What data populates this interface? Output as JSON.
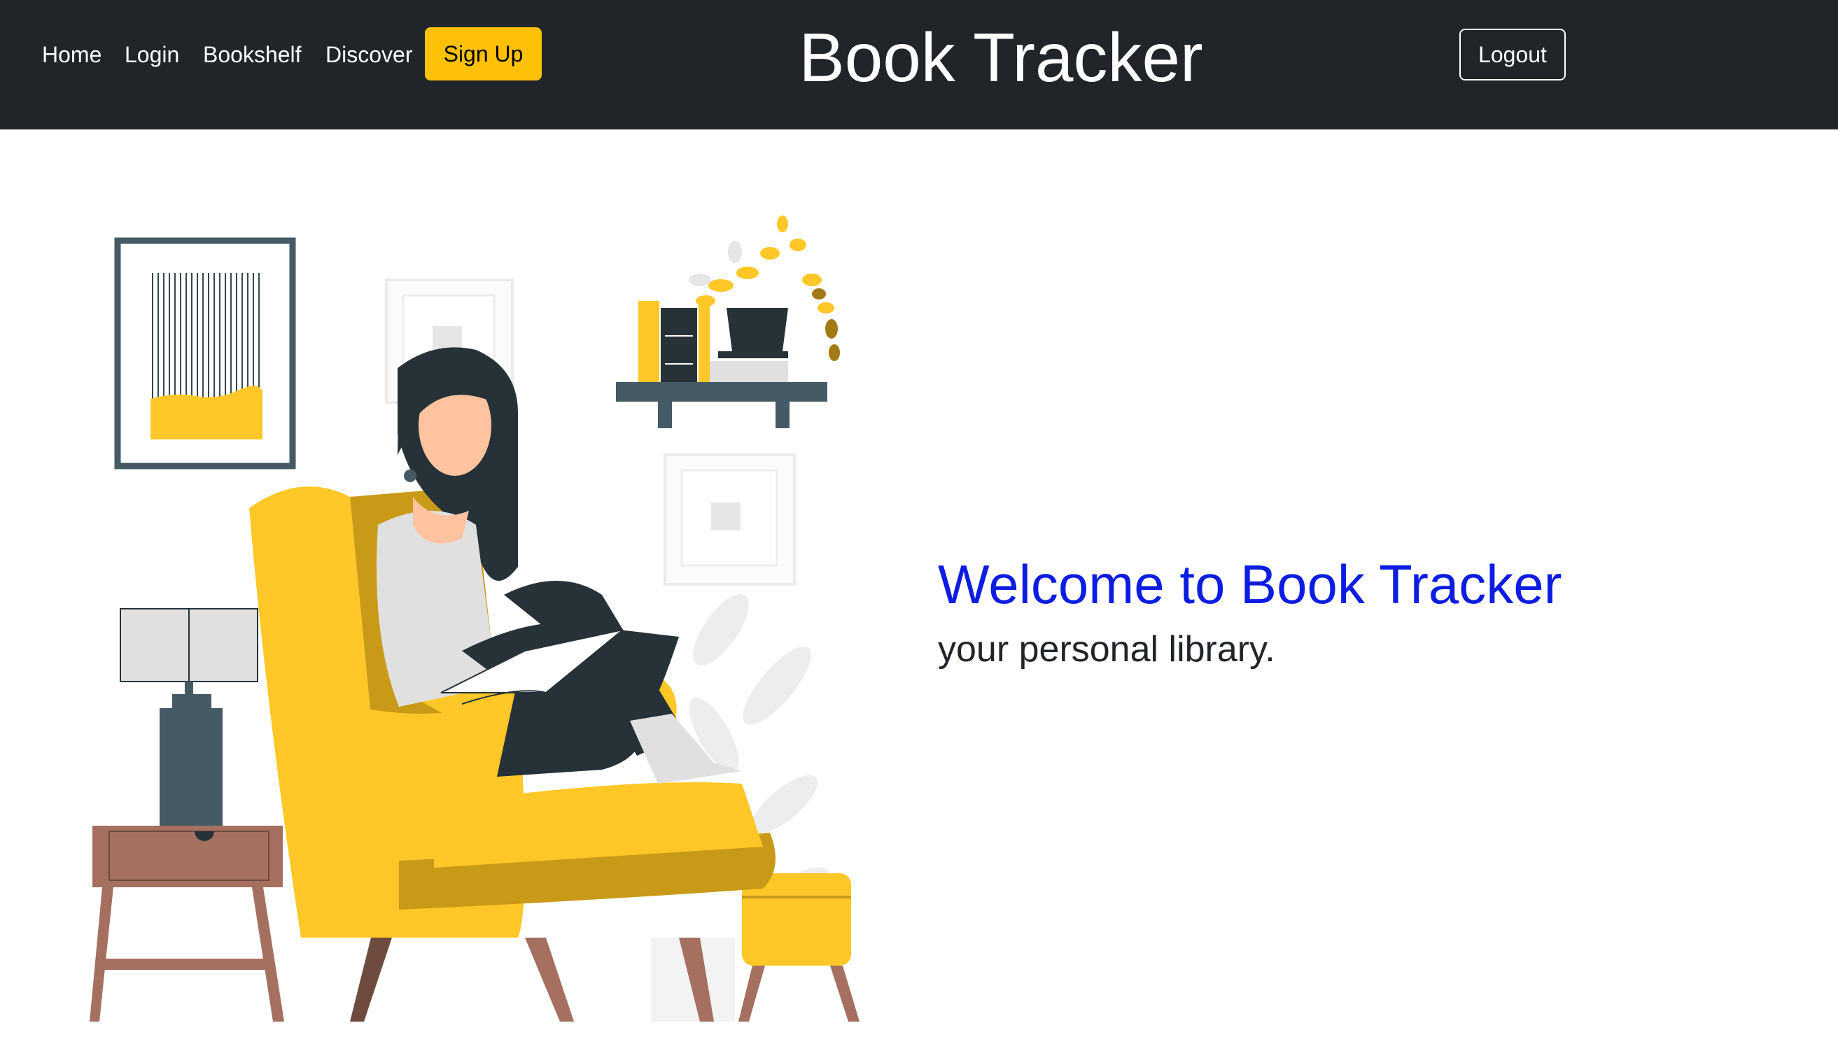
{
  "navbar": {
    "links": [
      {
        "label": "Home"
      },
      {
        "label": "Login"
      },
      {
        "label": "Bookshelf"
      },
      {
        "label": "Discover"
      }
    ],
    "signup_label": "Sign Up",
    "brand": "Book Tracker",
    "logout_label": "Logout"
  },
  "hero": {
    "title": "Welcome to Book Tracker",
    "subtitle": "your personal library."
  },
  "colors": {
    "navbar_bg": "#212529",
    "accent_yellow": "#ffc107",
    "title_blue": "#0d1de0"
  },
  "icons": [
    "woman-reading-illustration"
  ]
}
